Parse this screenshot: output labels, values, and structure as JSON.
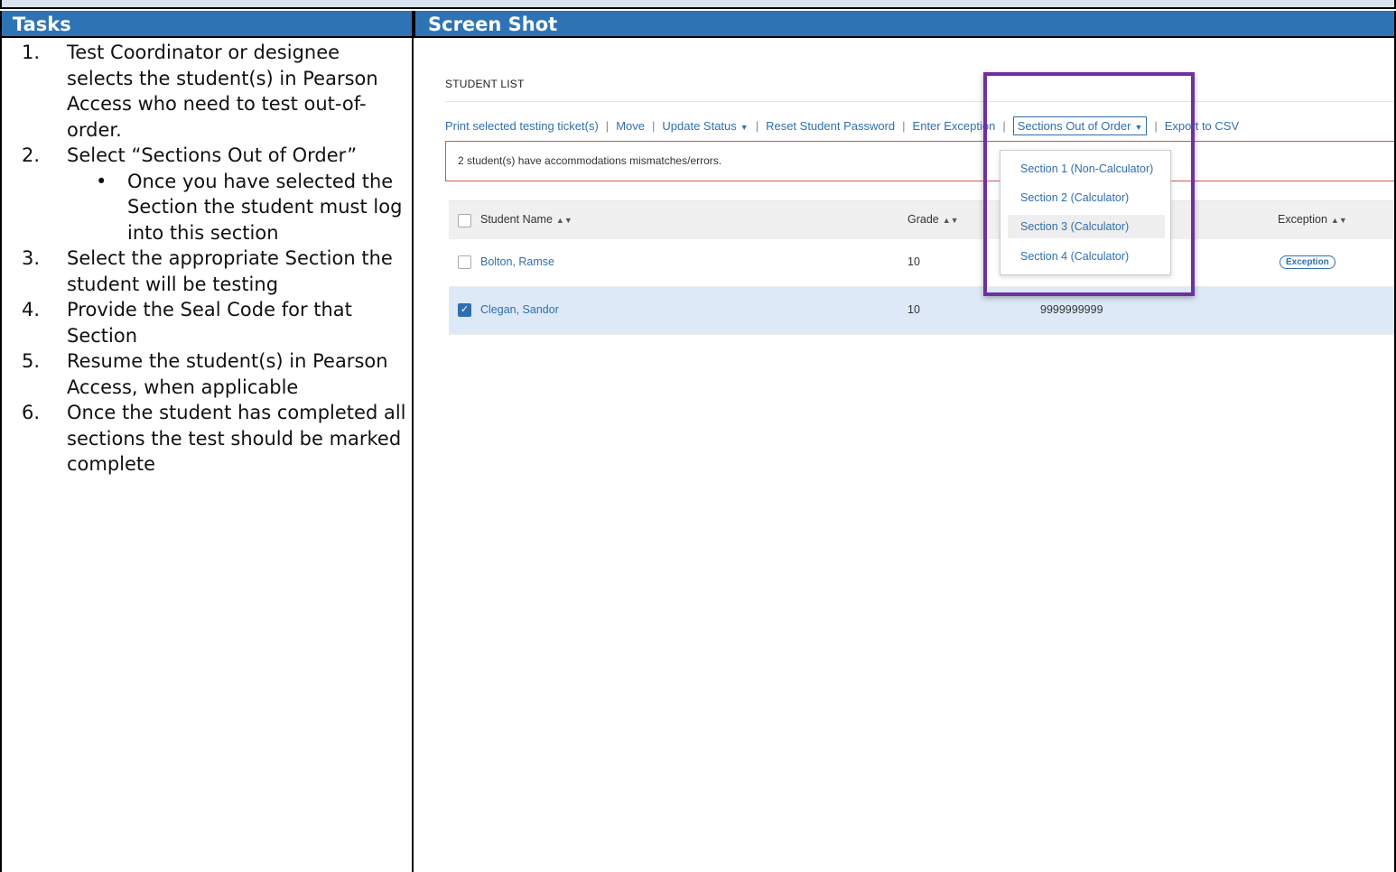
{
  "table_headers": {
    "tasks": "Tasks",
    "screenshot": "Screen Shot"
  },
  "tasks": [
    {
      "num": "1.",
      "text": "Test Coordinator or designee selects the student(s) in Pearson Access who need to test out-of-order."
    },
    {
      "num": "2.",
      "text": "Select “Sections Out of Order”",
      "sub": [
        "Once you have selected the Section the student must log into this section"
      ]
    },
    {
      "num": "3.",
      "text": "Select the appropriate Section the student will be testing"
    },
    {
      "num": "4.",
      "text": "Provide the Seal Code for that Section"
    },
    {
      "num": "5.",
      "text": "Resume the student(s) in Pearson Access, when applicable"
    },
    {
      "num": "6.",
      "text": "Once the student has completed all sections the test should be marked complete"
    }
  ],
  "screenshot": {
    "title": "STUDENT LIST",
    "toolbar": {
      "print": "Print selected testing ticket(s)",
      "move": "Move",
      "update_status": "Update Status",
      "reset_password": "Reset Student Password",
      "enter_exception": "Enter Exception",
      "sections_out_of_order": "Sections Out of Order",
      "export": "Export to CSV"
    },
    "alert": "2 student(s) have accommodations mismatches/errors.",
    "columns": {
      "name": "Student Name",
      "grade": "Grade",
      "exception": "Exception"
    },
    "rows": [
      {
        "name": "Bolton, Ramse",
        "grade": "10",
        "id": "",
        "exception": "Exception",
        "checked": false
      },
      {
        "name": "Clegan, Sandor",
        "grade": "10",
        "id": "9999999999",
        "exception": "",
        "checked": true
      }
    ],
    "dropdown": [
      "Section 1 (Non-Calculator)",
      "Section 2 (Calculator)",
      "Section 3 (Calculator)",
      "Section 4 (Calculator)"
    ],
    "highlight_color": "#7030a0",
    "header_color": "#2e74b5"
  }
}
